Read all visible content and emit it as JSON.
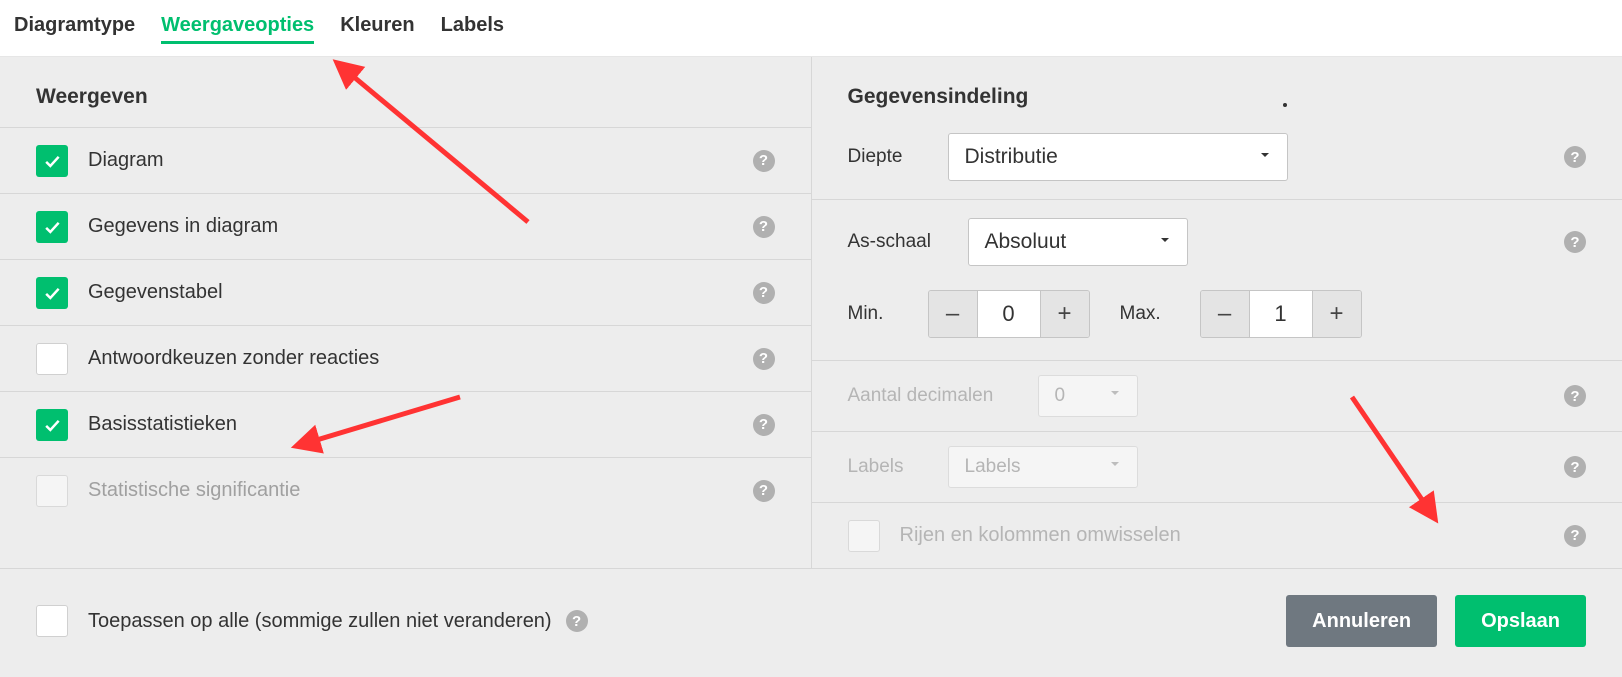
{
  "tabs": {
    "diagramtype": "Diagramtype",
    "weergaveopties": "Weergaveopties",
    "kleuren": "Kleuren",
    "labels": "Labels"
  },
  "left": {
    "header": "Weergeven",
    "items": [
      {
        "label": "Diagram",
        "checked": true
      },
      {
        "label": "Gegevens in diagram",
        "checked": true
      },
      {
        "label": "Gegevenstabel",
        "checked": true
      },
      {
        "label": "Antwoordkeuzen zonder reacties",
        "checked": false
      },
      {
        "label": "Basisstatistieken",
        "checked": true
      },
      {
        "label": "Statistische significantie",
        "checked": false,
        "disabled": true
      }
    ]
  },
  "right": {
    "header": "Gegevensindeling",
    "diepte": {
      "label": "Diepte",
      "value": "Distributie"
    },
    "asschaal": {
      "label": "As-schaal",
      "value": "Absoluut"
    },
    "minmax": {
      "min_label": "Min.",
      "min_value": "0",
      "max_label": "Max.",
      "max_value": "1"
    },
    "decimals": {
      "label": "Aantal decimalen",
      "value": "0",
      "disabled": true
    },
    "labels": {
      "label": "Labels",
      "value": "Labels",
      "disabled": true
    },
    "swap": {
      "label": "Rijen en kolommen omwisselen",
      "disabled": true
    }
  },
  "footer": {
    "apply_all": "Toepassen op alle (sommige zullen niet veranderen)",
    "cancel": "Annuleren",
    "save": "Opslaan"
  }
}
